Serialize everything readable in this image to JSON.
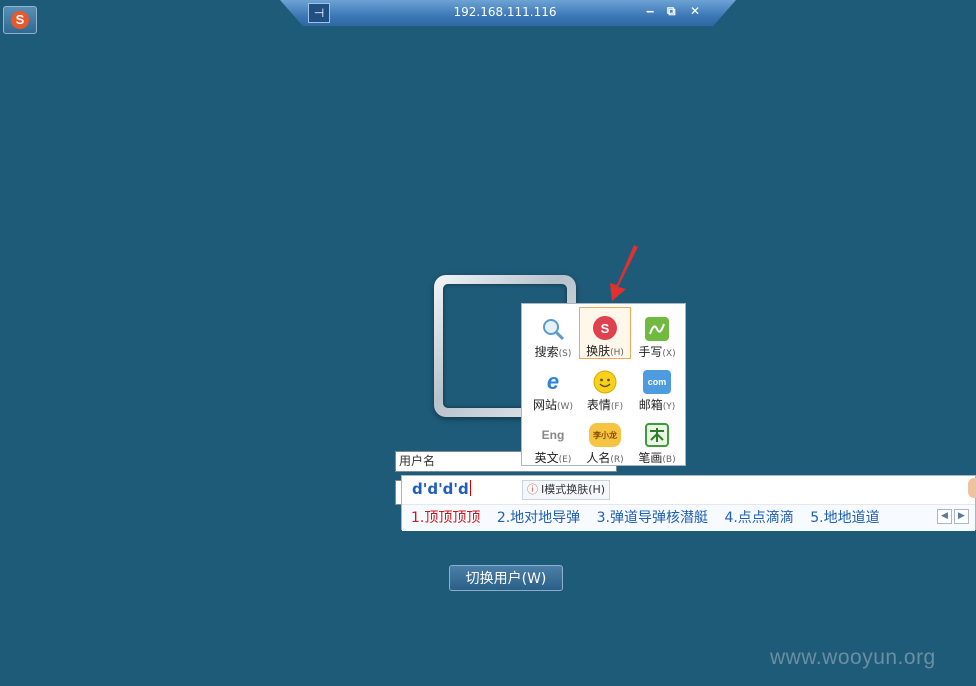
{
  "rdp": {
    "title": "192.168.111.116",
    "pin_glyph": "⊣",
    "minimize": "‒",
    "restore": "⧉",
    "close": "✕"
  },
  "sogou": {
    "logo": "S"
  },
  "login": {
    "username_placeholder": "用户名",
    "switch_user_label": "切换用户(W)"
  },
  "ime_menu": {
    "items": [
      {
        "label": "搜索",
        "key": "(S)",
        "icon": "search-icon"
      },
      {
        "label": "换肤",
        "key": "(H)",
        "icon": "skin-icon"
      },
      {
        "label": "手写",
        "key": "(X)",
        "icon": "handwriting-icon"
      },
      {
        "label": "网站",
        "key": "(W)",
        "icon": "ie-icon"
      },
      {
        "label": "表情",
        "key": "(F)",
        "icon": "smiley-icon"
      },
      {
        "label": "邮箱",
        "key": "(Y)",
        "icon": "mail-icon"
      },
      {
        "label": "英文",
        "key": "(E)",
        "icon": "english-icon"
      },
      {
        "label": "人名",
        "key": "(R)",
        "icon": "person-name-icon"
      },
      {
        "label": "笔画",
        "key": "(B)",
        "icon": "stroke-icon"
      }
    ],
    "icon_text": {
      "skin": "S",
      "english": "Eng",
      "person": "李小龙",
      "mail": "com"
    }
  },
  "candidate": {
    "input": "d'd'd'd",
    "hint": "I模式换肤(H)",
    "items": [
      "1.顶顶顶顶",
      "2.地对地导弹",
      "3.弹道导弹核潜艇",
      "4.点点滴滴",
      "5.地地道道"
    ],
    "prev": "◀",
    "next": "▶"
  },
  "watermark": "www.wooyun.org",
  "colors": {
    "desktop": "#1e5b78",
    "candidate_first": "#d0161b",
    "candidate": "#1f5fb5"
  }
}
